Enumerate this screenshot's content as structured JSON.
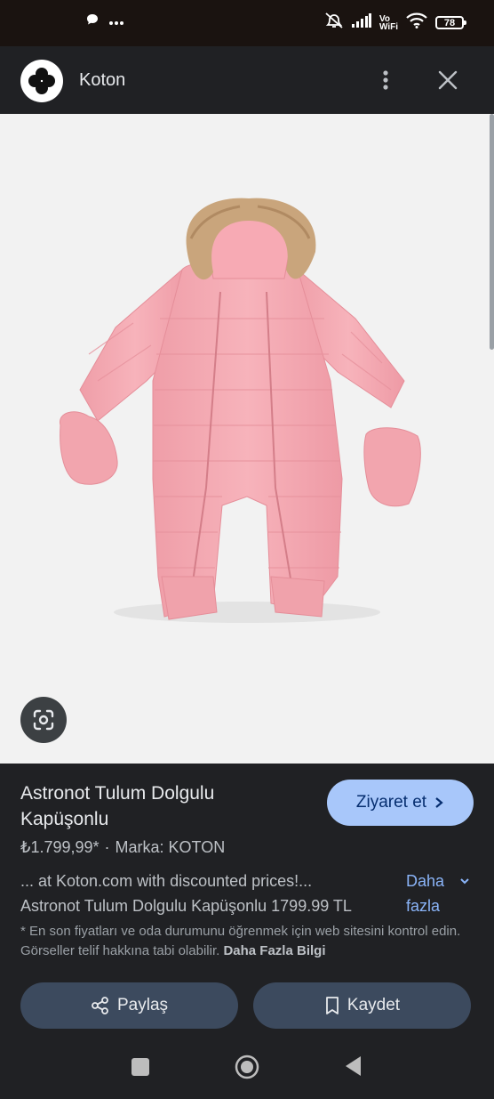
{
  "status_bar": {
    "battery": "78",
    "vowifi_top": "Vo",
    "vowifi_bottom": "WiFi",
    "icons": [
      "chat-bubble-icon",
      "more-dots-icon",
      "mute-icon",
      "signal-icon",
      "wifi-icon",
      "battery-icon"
    ]
  },
  "header": {
    "site_name": "Koton",
    "icons": [
      "koton-logo",
      "more-vert-icon",
      "close-icon"
    ]
  },
  "product": {
    "title": "Astronot Tulum Dolgulu Kapüşonlu",
    "price": "₺1.799,99*",
    "separator": "·",
    "brand": "Marka: KOTON",
    "visit_label": "Ziyaret et",
    "desc_line1": "... at Koton.com with discounted prices!...",
    "desc_line2": "Astronot Tulum Dolgulu Kapüşonlu 1799.99 TL",
    "more_line1": "Daha",
    "more_line2": "fazla",
    "disclaimer": "* En son fiyatları ve oda durumunu öğrenmek için web sitesini kontrol edin. Görseller telif hakkına tabi olabilir.",
    "disclaimer_link": "Daha Fazla Bilgi"
  },
  "actions": {
    "share_label": "Paylaş",
    "save_label": "Kaydet"
  },
  "colors": {
    "accent": "#a8c7fa",
    "link": "#8ab4f8",
    "panel_bg": "#202124",
    "button_bg": "#3c4a5e",
    "product_pink": "#f4a7b0"
  }
}
